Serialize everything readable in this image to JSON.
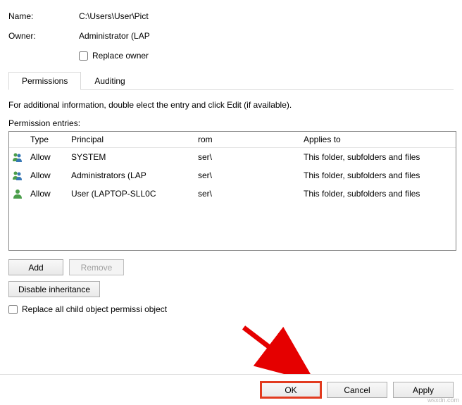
{
  "fields": {
    "name_label": "Name:",
    "name_value": "C:\\Users\\User\\Pict",
    "owner_label": "Owner:",
    "owner_value": "Administrator (LAP",
    "replace_owner_label": "Replace owner"
  },
  "tabs": {
    "permissions": "Permissions",
    "auditing": "Auditing"
  },
  "info_text": "For additional information, double        elect the entry and click Edit (if available).",
  "entries_label": "Permission entries:",
  "headers": {
    "type": "Type",
    "principal": "Principal",
    "from": "rom",
    "applies": "Applies to"
  },
  "rows": [
    {
      "type": "Allow",
      "principal": "SYSTEM",
      "from": "ser\\",
      "applies": "This folder, subfolders and files"
    },
    {
      "type": "Allow",
      "principal": "Administrators (LAP",
      "from": "ser\\",
      "applies": "This folder, subfolders and files"
    },
    {
      "type": "Allow",
      "principal": "User (LAPTOP-SLL0C",
      "from": "ser\\",
      "applies": "This folder, subfolders and files"
    }
  ],
  "buttons": {
    "add": "Add",
    "remove": "Remove",
    "disable_inheritance": "Disable inheritance",
    "ok": "OK",
    "cancel": "Cancel",
    "apply": "Apply"
  },
  "replace_child_label": "Replace all child object permissi        object",
  "watermark": "wsxdn.com"
}
